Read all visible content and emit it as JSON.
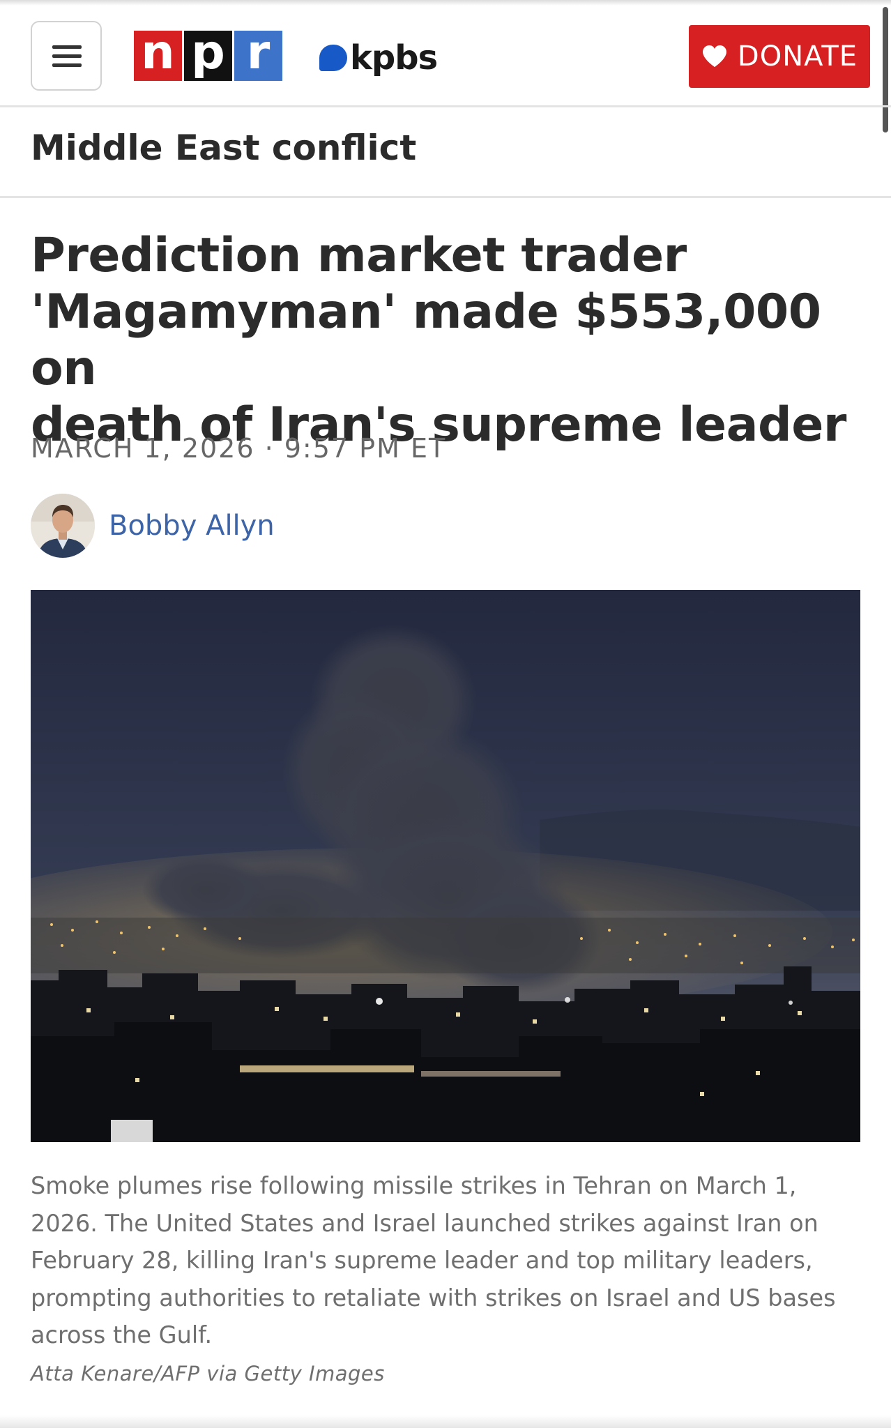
{
  "header": {
    "menu_icon": "hamburger-menu-icon",
    "npr_logo": [
      "n",
      "p",
      "r"
    ],
    "station_logo": "kpbs",
    "donate_label": "DONATE",
    "donate_icon": "heart-icon",
    "colors": {
      "npr_red": "#d62021",
      "npr_black": "#111111",
      "npr_blue": "#3d73c9",
      "kpbs_blue": "#1659c7",
      "donate_bg": "#d62021",
      "author_link": "#3e64a8"
    }
  },
  "section": {
    "title": "Middle East conflict"
  },
  "article": {
    "headline_lines": [
      "Prediction market trader",
      "'Magamyman' made $553,000 on",
      "death of Iran's supreme leader"
    ],
    "dateline": "MARCH 1, 2026 · 9:57 PM ET",
    "author": "Bobby Allyn",
    "image": {
      "caption_lines": [
        "Smoke plumes rise following missile strikes in Tehran on March 1,",
        "2026. The United States and Israel launched strikes against Iran on",
        "February 28, killing Iran's supreme leader and top military leaders,",
        "prompting authorities to retaliate with strikes on Israel and US bases",
        "across the Gulf."
      ],
      "credit": "Atta Kenare/AFP via Getty Images"
    }
  }
}
